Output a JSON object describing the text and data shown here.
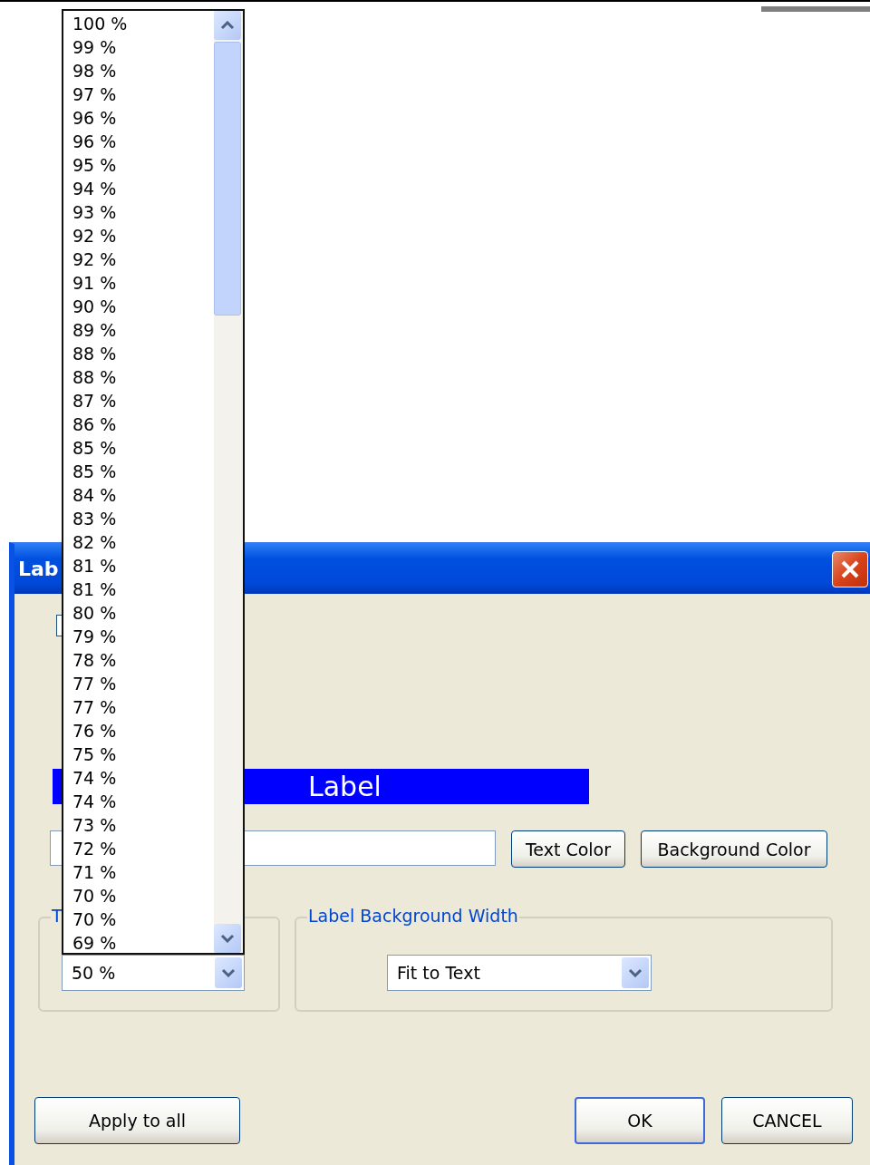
{
  "window": {
    "title": "Lab"
  },
  "dropdown_list": {
    "items": [
      "100 %",
      "99 %",
      "98 %",
      "97 %",
      "96 %",
      "96 %",
      "95 %",
      "94 %",
      "93 %",
      "92 %",
      "92 %",
      "91 %",
      "90 %",
      "89 %",
      "88 %",
      "88 %",
      "87 %",
      "86 %",
      "85 %",
      "85 %",
      "84 %",
      "83 %",
      "82 %",
      "81 %",
      "81 %",
      "80 %",
      "79 %",
      "78 %",
      "77 %",
      "77 %",
      "76 %",
      "75 %",
      "74 %",
      "74 %",
      "73 %",
      "72 %",
      "71 %",
      "70 %",
      "70 %",
      "69 %"
    ]
  },
  "preview": {
    "label": "Label"
  },
  "color_buttons": [
    "Text Color",
    "Background Color"
  ],
  "groups": [
    {
      "title": "T",
      "value": "50 %"
    },
    {
      "title": "Label Background Width",
      "value": "Fit to Text"
    }
  ],
  "apply_button": "Apply to all",
  "dialog_buttons": [
    {
      "label": "OK",
      "default": true
    },
    {
      "label": "CANCEL",
      "default": false
    }
  ]
}
